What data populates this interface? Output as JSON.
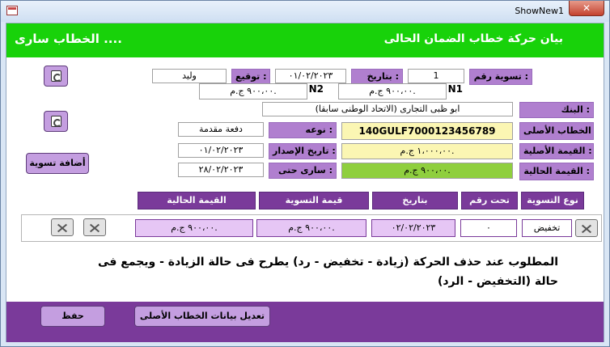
{
  "window": {
    "title": "ShowNew1",
    "close_glyph": "✕"
  },
  "header": {
    "title": "بيان حركة خطاب الضمان الحالى",
    "status": "الخطاب سارى ...."
  },
  "settlement": {
    "no_label": "تسوية رقم :",
    "no_value": "1",
    "date_label": "بتاريخ :",
    "date_value": "٠١/٠٢/٢٠٢٣",
    "sign_label": "توقيع :",
    "sign_value": "وليد",
    "n1_tag": "N1",
    "n1_value": "٩٠٠،٠٠ ج.م.",
    "n2_tag": "N2",
    "n2_value": "٩٠٠،٠٠ ج.م."
  },
  "letter": {
    "bank_label": "البنك :",
    "bank_value": "ابو ظبى التجارى (الاتحاد الوطنى سابقا)",
    "ref_label": "رقم الخطاب الأصلى :",
    "ref_value": "140GULF7000123456789",
    "orig_label": "القيمة الأصلية :",
    "orig_value": "١،٠٠٠،٠٠ ج.م.",
    "curr_label": "القيمة الحالية :",
    "curr_value": "٩٠٠،٠٠ ج.م.",
    "type_label": "نوعه :",
    "type_value": "دفعة مقدمة",
    "issue_label": "تاريخ الإصدار :",
    "issue_value": "٠١/٠٢/٢٠٢٣",
    "valid_label": "سارى حتى :",
    "valid_value": "٢٨/٠٢/٢٠٢٣"
  },
  "buttons": {
    "add_settlement": "أضافة تسوية",
    "save": "حفظ",
    "edit_original": "تعديل بيانات الخطاب الأصلى"
  },
  "grid": {
    "headers": [
      "نوع التسوية",
      "تحت رقم",
      "بتاريخ",
      "قيمة التسوية",
      "القيمة الحالية"
    ],
    "row": [
      "تخفيض",
      "٠",
      "٠٢/٠٢/٢٠٢٣",
      "٩٠٠،٠٠ ج.م.",
      "٩٠٠،٠٠ ج.م."
    ]
  },
  "note": {
    "line1": "المطلوب عند حذف الحركة (زيادة - تخفيض - رد) يطرح فى حالة الزيادة - ويجمع فى",
    "line2": "حالة (التخفيض - الرد)"
  },
  "icons": [
    "refresh-icon",
    "refresh-icon",
    "delete-x-icon",
    "delete-x-icon",
    "delete-x-icon"
  ],
  "colors": {
    "header": "#18d20a",
    "label": "#b07fcf",
    "grid_head": "#7a3a9a",
    "footer": "#7a3a9a"
  }
}
